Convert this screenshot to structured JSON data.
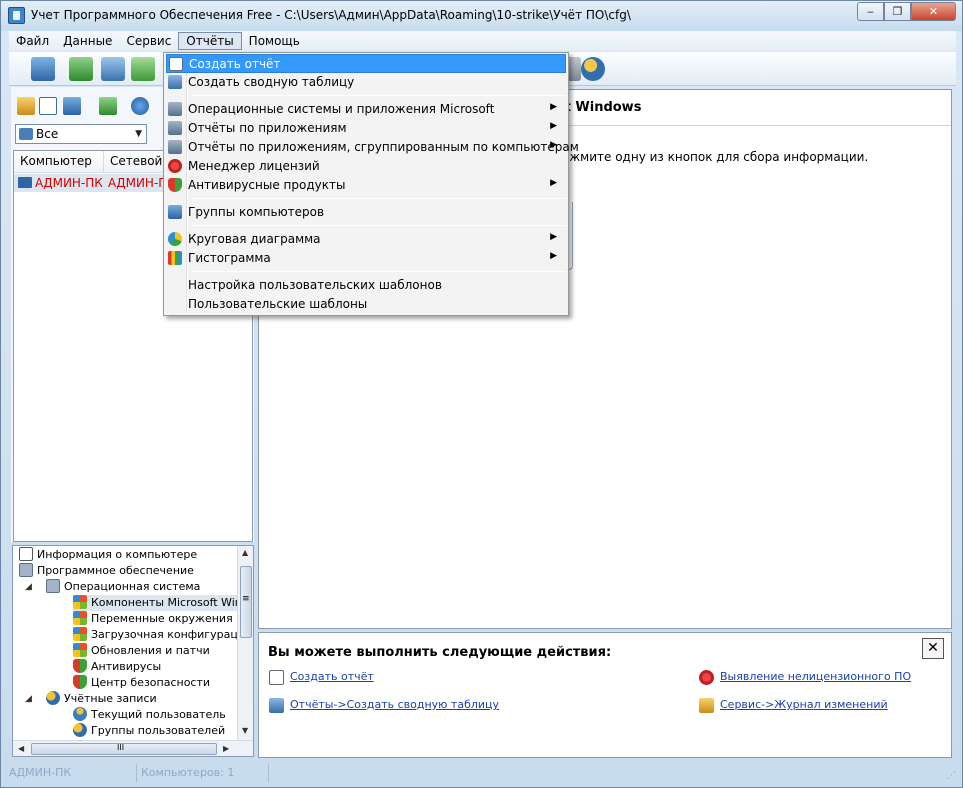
{
  "window": {
    "title": "Учет Программного Обеспечения Free - C:\\Users\\Админ\\AppData\\Roaming\\10-strike\\Учёт ПО\\cfg\\",
    "minimize": "‒",
    "maximize": "❐",
    "close": "✕"
  },
  "menubar": [
    "Файл",
    "Данные",
    "Сервис",
    "Отчёты",
    "Помощь"
  ],
  "toolbar_icons": [
    "computer-add-icon",
    "network-scan-icon",
    "ip-scan-icon",
    "computer-plus-icon",
    "user-report-icon",
    "user-group-icon"
  ],
  "left": {
    "filter": "Все",
    "columns": [
      "Компьютер",
      "Сетевой а"
    ],
    "rows": [
      [
        "АДМИН-ПК",
        "АДМИН-ПК"
      ]
    ]
  },
  "tree": [
    {
      "label": "Информация о компьютере",
      "icon": "doc"
    },
    {
      "label": "Программное обеспечение",
      "icon": "soft"
    },
    {
      "label": "Операционная система",
      "icon": "soft"
    },
    {
      "label": "Компоненты Microsoft Windo",
      "icon": "win"
    },
    {
      "label": "Переменные окружения",
      "icon": "win"
    },
    {
      "label": "Загрузочная конфигурация",
      "icon": "win"
    },
    {
      "label": "Обновления и патчи",
      "icon": "win"
    },
    {
      "label": "Антивирусы",
      "icon": "shield"
    },
    {
      "label": "Центр безопасности",
      "icon": "shield"
    },
    {
      "label": "Учётные записи",
      "icon": "users"
    },
    {
      "label": "Текущий пользователь",
      "icon": "user"
    },
    {
      "label": "Группы пользователей",
      "icon": "users"
    }
  ],
  "right": {
    "title": "ft Windows",
    "message": "ажмите одну из кнопок для сбора информации."
  },
  "actions": {
    "title": "Вы можете выполнить следующие действия:",
    "close": "✕",
    "links": [
      "Создать отчёт",
      "Отчёты->Создать сводную таблицу",
      "Выявление нелицензионного ПО",
      "Сервис->Журнал изменений"
    ]
  },
  "statusbar": [
    "АДМИН-ПК",
    "Компьютеров: 1"
  ],
  "dropdown": [
    {
      "label": "Создать отчёт",
      "submenu": false,
      "selected": true
    },
    {
      "label": "Создать сводную таблицу",
      "submenu": false
    },
    {
      "label": "Операционные системы и приложения Microsoft",
      "submenu": true
    },
    {
      "label": "Отчёты по приложениям",
      "submenu": true
    },
    {
      "label": "Отчёты по приложениям, сгруппированным по компьютерам",
      "submenu": true
    },
    {
      "label": "Менеджер лицензий",
      "submenu": false
    },
    {
      "label": "Антивирусные продукты",
      "submenu": true
    },
    {
      "label": "Группы компьютеров",
      "submenu": false
    },
    {
      "label": "Круговая диаграмма",
      "submenu": true
    },
    {
      "label": "Гистограмма",
      "submenu": true
    },
    {
      "label": "Настройка пользовательских шаблонов",
      "submenu": false
    },
    {
      "label": "Пользовательские шаблоны",
      "submenu": false
    }
  ],
  "glyphs": {
    "submenu_arrow": "▶",
    "combo_arrow": "▼",
    "expand": "◢",
    "scroll_up": "▲",
    "scroll_down": "▼",
    "scroll_left": "◀",
    "scroll_right": "▶",
    "hthumb": "III",
    "vthumb": "≡",
    "grip": "⋰"
  },
  "colors": {
    "accent": "#3399ff",
    "link": "#1a3fb0",
    "warning_text": "#d40000"
  }
}
